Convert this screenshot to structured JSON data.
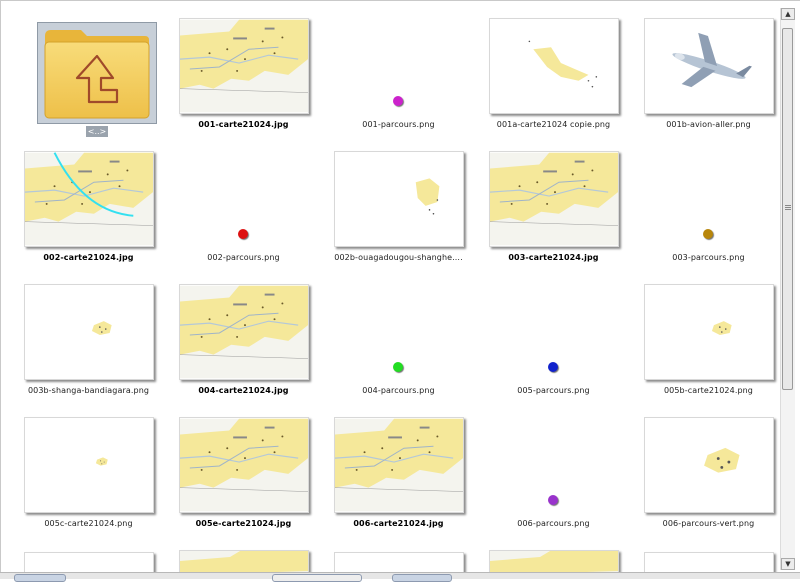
{
  "up": {
    "label": "<..>"
  },
  "files": [
    {
      "name": "001-carte21024.jpg",
      "bold": true,
      "kind": "map"
    },
    {
      "name": "001-parcours.png",
      "bold": false,
      "kind": "dot",
      "color": "#cc22cc"
    },
    {
      "name": "001a-carte21024 copie.png",
      "bold": false,
      "kind": "partial"
    },
    {
      "name": "001b-avion-aller.png",
      "bold": false,
      "kind": "plane"
    },
    {
      "name": "002-carte21024.jpg",
      "bold": true,
      "kind": "map-arc"
    },
    {
      "name": "002-parcours.png",
      "bold": false,
      "kind": "dot",
      "color": "#dd1111"
    },
    {
      "name": "002b-ouagadougou-shanghe....",
      "bold": false,
      "kind": "partial-small"
    },
    {
      "name": "003-carte21024.jpg",
      "bold": true,
      "kind": "map"
    },
    {
      "name": "003-parcours.png",
      "bold": false,
      "kind": "dot",
      "color": "#b8860b"
    },
    {
      "name": "003b-shanga-bandiagara.png",
      "bold": false,
      "kind": "speck"
    },
    {
      "name": "004-carte21024.jpg",
      "bold": true,
      "kind": "map"
    },
    {
      "name": "004-parcours.png",
      "bold": false,
      "kind": "dot",
      "color": "#22dd22"
    },
    {
      "name": "005-parcours.png",
      "bold": false,
      "kind": "dot",
      "color": "#1122cc"
    },
    {
      "name": "005b-carte21024.png",
      "bold": false,
      "kind": "speck"
    },
    {
      "name": "005c-carte21024.png",
      "bold": false,
      "kind": "speck-small"
    },
    {
      "name": "005e-carte21024.jpg",
      "bold": true,
      "kind": "map"
    },
    {
      "name": "006-carte21024.jpg",
      "bold": true,
      "kind": "map"
    },
    {
      "name": "006-parcours.png",
      "bold": false,
      "kind": "dot",
      "color": "#9933cc"
    },
    {
      "name": "006-parcours-vert.png",
      "bold": false,
      "kind": "speck-large"
    }
  ]
}
